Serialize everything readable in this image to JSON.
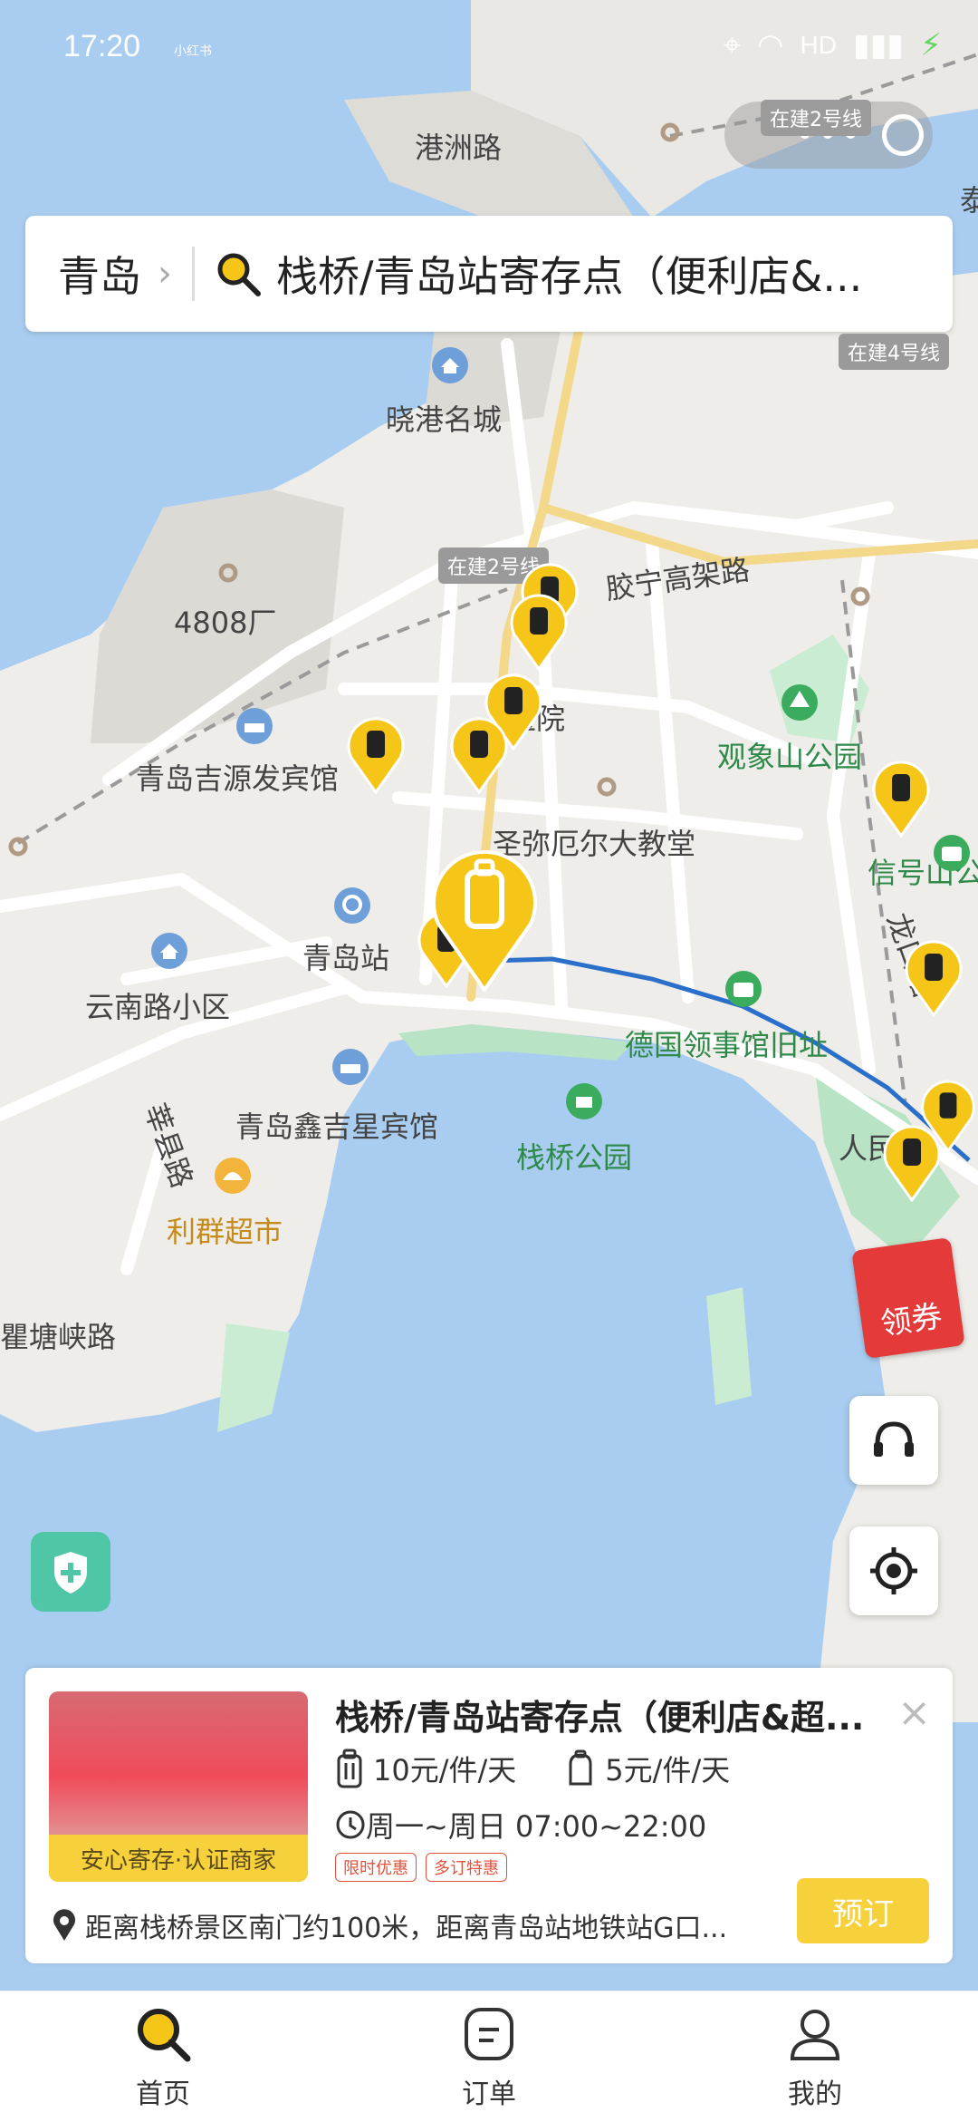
{
  "status_bar": {
    "time": "17:20",
    "small_text": "小红书",
    "network": "HD"
  },
  "top_right": {
    "badge": "在建2号线",
    "dots": "•••"
  },
  "search_bar": {
    "city": "青岛",
    "query": "栈桥/青岛站寄存点（便利店&..."
  },
  "map": {
    "labels": [
      "港洲路",
      "晓港名城",
      "4808厂",
      "胶宁高架路",
      "青岛吉源发宾馆",
      "观象山公园",
      "圣弥厄尔大教堂",
      "青岛站",
      "云南路小区",
      "信号山公",
      "德国领事馆旧址",
      "青岛鑫吉星宾馆",
      "栈桥公园",
      "利群超市",
      "人民",
      "瞿塘峡路",
      "龙口路",
      "莘县路",
      "医院",
      "泰"
    ],
    "road_tags": [
      "在建4号线",
      "在建2号线"
    ]
  },
  "floating": {
    "coupon_label": "领券"
  },
  "card": {
    "title": "栈桥/青岛站寄存点（便利店&超...",
    "badge": "安心寄存·认证商家",
    "price_luggage": "10元/件/天",
    "price_bag": "5元/件/天",
    "hours": "周一~周日 07:00~22:00",
    "tags": [
      "限时优惠",
      "多订特惠"
    ],
    "address": "距离栈桥景区南门约100米，距离青岛站地铁站G口...",
    "book_label": "预订",
    "close_label": "×"
  },
  "tabs": [
    {
      "label": "首页",
      "icon": "search-icon"
    },
    {
      "label": "订单",
      "icon": "order-icon"
    },
    {
      "label": "我的",
      "icon": "user-icon"
    }
  ]
}
